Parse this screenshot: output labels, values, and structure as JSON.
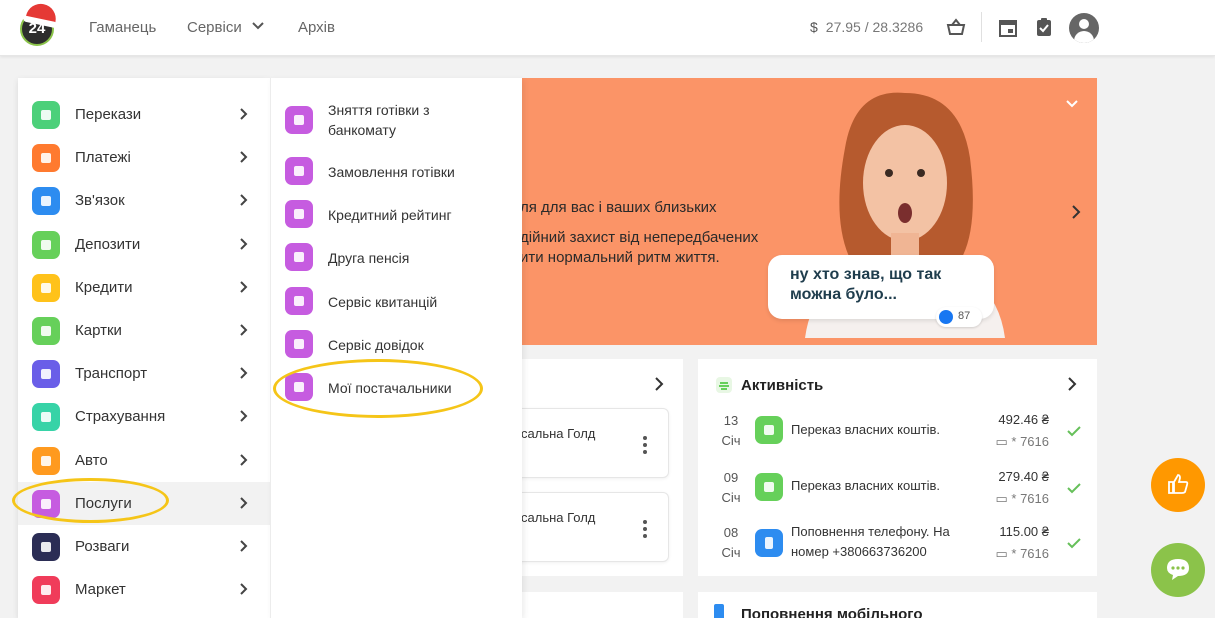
{
  "header": {
    "logo_text": "24",
    "nav": {
      "wallet": "Гаманець",
      "services": "Сервіси",
      "archive": "Архів"
    },
    "rate_symbol": "$",
    "rate_value": "27.95 / 28.3286",
    "icons": [
      "basket-icon",
      "calendar-icon",
      "clipboard-check-icon",
      "user-avatar-icon"
    ]
  },
  "menu": {
    "items": [
      {
        "label": "Перекази",
        "icon": "transfers-icon",
        "color": "#4cd07a"
      },
      {
        "label": "Платежі",
        "icon": "payments-icon",
        "color": "#ff7a2f"
      },
      {
        "label": "Зв'язок",
        "icon": "signal-icon",
        "color": "#2d8cf0"
      },
      {
        "label": "Депозити",
        "icon": "percent-icon",
        "color": "#66d05a"
      },
      {
        "label": "Кредити",
        "icon": "money-bag-icon",
        "color": "#ffc21a"
      },
      {
        "label": "Картки",
        "icon": "card-icon",
        "color": "#66d05a"
      },
      {
        "label": "Транспорт",
        "icon": "ticket-icon",
        "color": "#6a5ee8"
      },
      {
        "label": "Страхування",
        "icon": "umbrella-icon",
        "color": "#37d3a7"
      },
      {
        "label": "Авто",
        "icon": "car-icon",
        "color": "#ff9a1f"
      },
      {
        "label": "Послуги",
        "icon": "puzzle-icon",
        "color": "#c65ce0"
      },
      {
        "label": "Розваги",
        "icon": "smile-icon",
        "color": "#2b2d55"
      },
      {
        "label": "Маркет",
        "icon": "cart-icon",
        "color": "#f03c5a"
      }
    ],
    "active_index": 9
  },
  "submenu": {
    "items": [
      {
        "label": "Зняття готівки з банкомату",
        "icon": "atm-icon"
      },
      {
        "label": "Замовлення готівки",
        "icon": "cash-icon"
      },
      {
        "label": "Кредитний рейтинг",
        "icon": "rating-icon"
      },
      {
        "label": "Друга пенсія",
        "icon": "pension-icon"
      },
      {
        "label": "Сервіс квитанцій",
        "icon": "receipt-icon"
      },
      {
        "label": "Сервіс довідок",
        "icon": "help-icon"
      },
      {
        "label": "Мої постачальники",
        "icon": "building-icon"
      }
    ],
    "color": "#c65ce0"
  },
  "banner": {
    "line1": "ля для вас і ваших близьких",
    "line2": "дійний захист від непередбачених",
    "line3": "ити нормальний ритм життя.",
    "bubble_text": "ну хто знав, що так можна було...",
    "likes": "87",
    "bg_color": "#fb9467"
  },
  "cards_panel": {
    "card1_text": "сальна Голд",
    "card2_text": "сальна Голд"
  },
  "activity": {
    "title": "Активність",
    "rows": [
      {
        "day": "13",
        "month": "Січ",
        "desc": "Переказ власних коштів.",
        "amount": "492.46 ₴",
        "card": "* 7616",
        "icon_color": "#66d05a"
      },
      {
        "day": "09",
        "month": "Січ",
        "desc": "Переказ власних коштів.",
        "amount": "279.40 ₴",
        "card": "* 7616",
        "icon_color": "#66d05a"
      },
      {
        "day": "08",
        "month": "Січ",
        "desc": "Поповнення телефону. На номер +380663736200",
        "amount": "115.00 ₴",
        "card": "* 7616",
        "icon_color": "#2d8cf0"
      }
    ]
  },
  "mobile_card": {
    "title": "Поповнення мобільного"
  }
}
